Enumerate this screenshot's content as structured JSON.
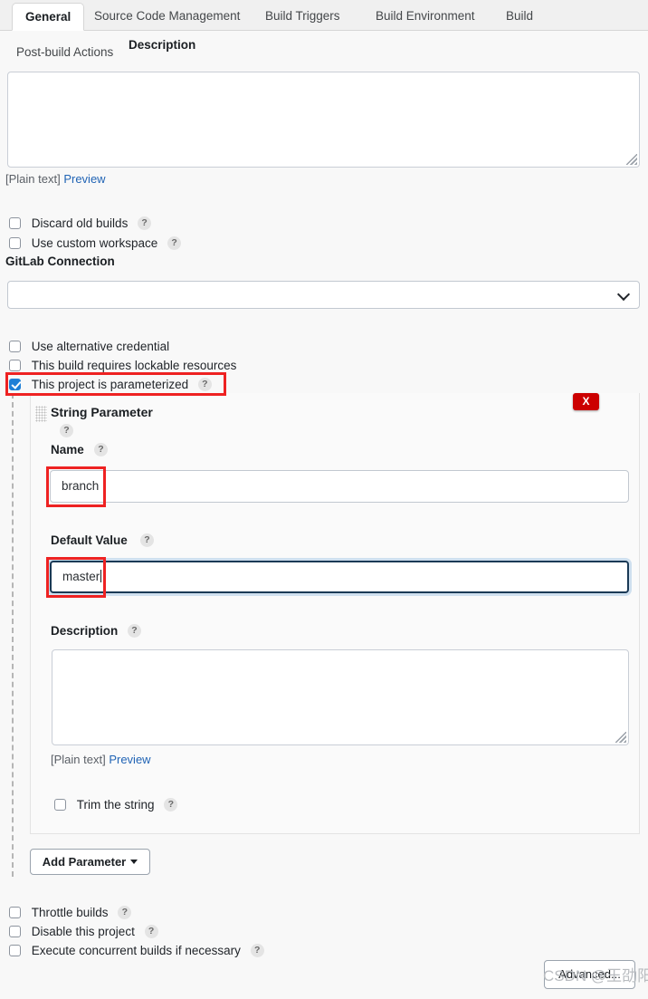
{
  "tabs": {
    "row1": [
      {
        "label": "General",
        "active": true
      },
      {
        "label": "Source Code Management",
        "active": false
      },
      {
        "label": "Build Triggers",
        "active": false
      },
      {
        "label": "Build Environment",
        "active": false
      },
      {
        "label": "Build",
        "active": false
      }
    ],
    "row2": {
      "label": "Post-build Actions"
    }
  },
  "description": {
    "heading": "Description",
    "value": "",
    "plain_text_label": "[Plain text]",
    "preview_link": "Preview"
  },
  "options": {
    "discard_old_builds": {
      "label": "Discard old builds",
      "checked": false,
      "help": "?"
    },
    "use_custom_workspace": {
      "label": "Use custom workspace",
      "checked": false,
      "help": "?"
    },
    "use_alternative_credential": {
      "label": "Use alternative credential",
      "checked": false
    },
    "lockable_resources": {
      "label": "This build requires lockable resources",
      "checked": false
    },
    "parameterized": {
      "label": "This project is parameterized",
      "checked": true,
      "help": "?"
    },
    "throttle_builds": {
      "label": "Throttle builds",
      "checked": false,
      "help": "?"
    },
    "disable_project": {
      "label": "Disable this project",
      "checked": false,
      "help": "?"
    },
    "concurrent_builds": {
      "label": "Execute concurrent builds if necessary",
      "checked": false,
      "help": "?"
    }
  },
  "gitlab": {
    "heading": "GitLab Connection",
    "selected": "",
    "chevron_icon": "chevron-down-icon"
  },
  "parameter": {
    "type_title": "String Parameter",
    "type_help": "?",
    "delete_label": "X",
    "drag_icon": "drag-handle-icon",
    "name": {
      "label": "Name",
      "help": "?",
      "value": "branch"
    },
    "default_value": {
      "label": "Default Value",
      "help": "?",
      "value": "master",
      "focused": true
    },
    "description": {
      "label": "Description",
      "help": "?",
      "value": "",
      "plain_text_label": "[Plain text]",
      "preview_link": "Preview"
    },
    "trim": {
      "label": "Trim the string",
      "checked": false,
      "help": "?"
    }
  },
  "buttons": {
    "add_parameter": "Add Parameter",
    "advanced": "Advanced..."
  },
  "watermark": "CSDN @王劭阳",
  "colors": {
    "accent": "#1f7fd6",
    "danger": "#cc0000",
    "annotation": "#ee2222",
    "link": "#2164b5"
  }
}
